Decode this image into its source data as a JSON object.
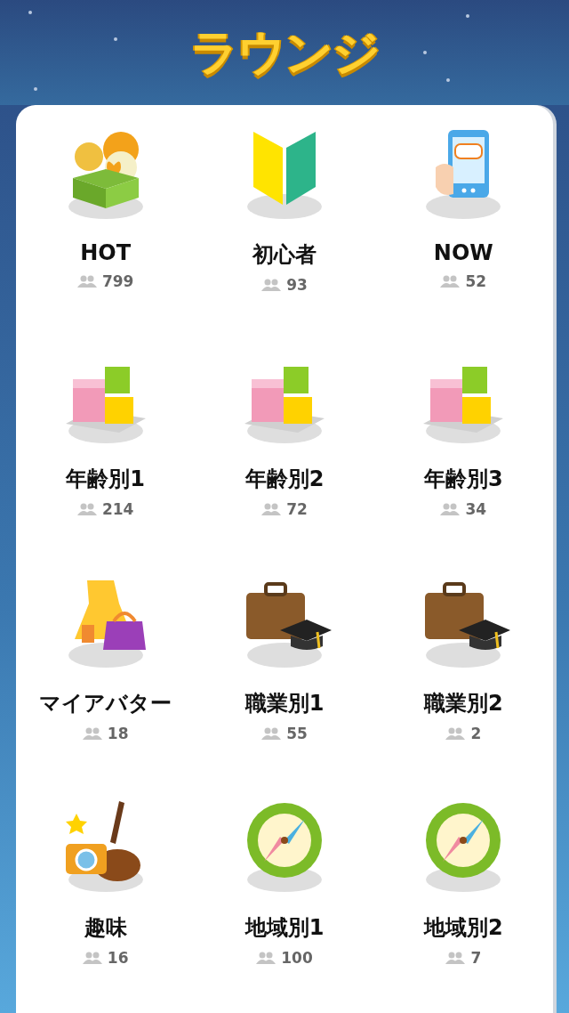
{
  "header": {
    "title": "ラウンジ"
  },
  "lounges": [
    {
      "kind": "hot",
      "name": "HOT",
      "members": "799"
    },
    {
      "kind": "beginner",
      "name": "初心者",
      "members": "93"
    },
    {
      "kind": "now",
      "name": "NOW",
      "members": "52"
    },
    {
      "kind": "age",
      "name": "年齢別1",
      "members": "214"
    },
    {
      "kind": "age",
      "name": "年齢別2",
      "members": "72"
    },
    {
      "kind": "age",
      "name": "年齢別3",
      "members": "34"
    },
    {
      "kind": "avatar",
      "name": "マイアバター",
      "members": "18"
    },
    {
      "kind": "job",
      "name": "職業別1",
      "members": "55"
    },
    {
      "kind": "job",
      "name": "職業別2",
      "members": "2"
    },
    {
      "kind": "hobby",
      "name": "趣味",
      "members": "16"
    },
    {
      "kind": "region",
      "name": "地域別1",
      "members": "100"
    },
    {
      "kind": "region",
      "name": "地域別2",
      "members": "7"
    }
  ]
}
